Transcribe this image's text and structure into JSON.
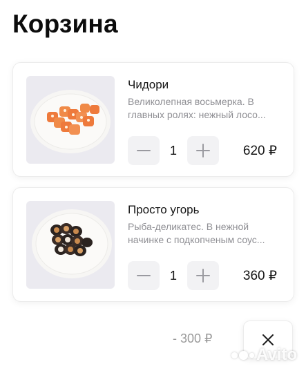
{
  "header": {
    "title": "Корзина"
  },
  "cart": {
    "items": [
      {
        "name": "Чидори",
        "desc_line1": "Великолепная восьмерка. В",
        "desc_line2": "главных ролях: нежный лосо...",
        "quantity": "1",
        "price": "620 ₽",
        "image_icon": "salmon-rolls-plate-icon"
      },
      {
        "name": "Просто угорь",
        "desc_line1": "Рыба-деликатес. В нежной",
        "desc_line2": "начинке с подкопченым соус...",
        "quantity": "1",
        "price": "360 ₽",
        "image_icon": "eel-rolls-plate-icon"
      }
    ]
  },
  "footer": {
    "discount": "- 300 ₽",
    "close_icon": "close-icon"
  },
  "watermark": {
    "text": "Avito"
  },
  "colors": {
    "card_border": "#ececec",
    "stepper_bg": "#f2f2f4",
    "muted_text": "#8e8e93",
    "thumb_bg": "#ebeaf0"
  }
}
